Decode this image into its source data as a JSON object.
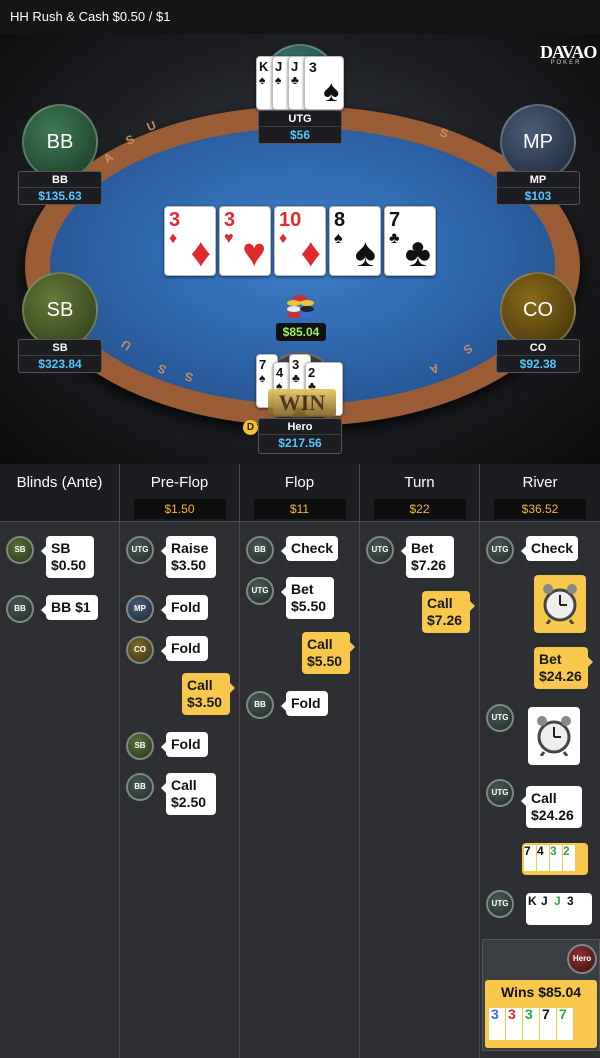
{
  "topbar": {
    "title": "HH  Rush & Cash $0.50 / $1"
  },
  "logo": {
    "brand": "DAVAO",
    "sub": "POKER"
  },
  "rail_letters": [
    "U",
    "S",
    "A",
    "S",
    "S",
    "U",
    "S",
    "A",
    "S",
    "U"
  ],
  "seats": {
    "utg": {
      "name": "UTG",
      "amount": "$56"
    },
    "bb": {
      "label": "BB",
      "name": "BB",
      "amount": "$135.63"
    },
    "mp": {
      "label": "MP",
      "name": "MP",
      "amount": "$103"
    },
    "sb": {
      "label": "SB",
      "name": "SB",
      "amount": "$323.84"
    },
    "co": {
      "label": "CO",
      "name": "CO",
      "amount": "$92.38"
    },
    "hero": {
      "name": "Hero",
      "amount": "$217.56"
    }
  },
  "utg_cards": [
    {
      "rank": "K",
      "suit": "♠"
    },
    {
      "rank": "J",
      "suit": "♠"
    },
    {
      "rank": "J",
      "suit": "♣"
    },
    {
      "rank": "3",
      "suit": "♠"
    }
  ],
  "hero_cards": [
    {
      "rank": "7",
      "suit": "♠"
    },
    {
      "rank": "4",
      "suit": "♠"
    },
    {
      "rank": "3",
      "suit": "♣"
    },
    {
      "rank": "2",
      "suit": "♣"
    }
  ],
  "board": [
    {
      "rank": "3",
      "suit": "♦",
      "color": "red"
    },
    {
      "rank": "3",
      "suit": "♥",
      "color": "red"
    },
    {
      "rank": "10",
      "suit": "♦",
      "color": "red"
    },
    {
      "rank": "8",
      "suit": "♠",
      "color": "blk"
    },
    {
      "rank": "7",
      "suit": "♣",
      "color": "blk"
    }
  ],
  "pot": "$85.04",
  "dealer": "D",
  "win_banner": "WIN",
  "columns": [
    {
      "name": "Blinds (Ante)",
      "pot": ""
    },
    {
      "name": "Pre-Flop",
      "pot": "$1.50"
    },
    {
      "name": "Flop",
      "pot": "$11"
    },
    {
      "name": "Turn",
      "pot": "$22"
    },
    {
      "name": "River",
      "pot": "$36.52"
    }
  ],
  "actions": {
    "blinds": [
      {
        "pos": "SB",
        "line1": "SB",
        "line2": "$0.50"
      },
      {
        "pos": "BB",
        "line1": "BB $1",
        "line2": ""
      }
    ],
    "preflop": [
      {
        "pos": "UTG",
        "line1": "Raise",
        "line2": "$3.50"
      },
      {
        "pos": "MP",
        "line1": "Fold",
        "line2": ""
      },
      {
        "pos": "CO",
        "line1": "Fold",
        "line2": ""
      },
      {
        "pos": "",
        "line1": "Call",
        "line2": "$3.50"
      },
      {
        "pos": "SB",
        "line1": "Fold",
        "line2": ""
      },
      {
        "pos": "BB",
        "line1": "Call",
        "line2": "$2.50"
      }
    ],
    "flop": [
      {
        "pos": "BB",
        "line1": "Check",
        "line2": ""
      },
      {
        "pos": "UTG",
        "line1": "Bet",
        "line2": "$5.50"
      },
      {
        "pos": "",
        "line1": "Call",
        "line2": "$5.50"
      },
      {
        "pos": "BB",
        "line1": "Fold",
        "line2": ""
      }
    ],
    "turn": [
      {
        "pos": "UTG",
        "line1": "Bet",
        "line2": "$7.26"
      },
      {
        "pos": "",
        "line1": "Call",
        "line2": "$7.26"
      }
    ],
    "river": [
      {
        "pos": "UTG",
        "line1": "Check",
        "line2": ""
      },
      {
        "pos": "",
        "line1": "Bet",
        "line2": "$24.26"
      },
      {
        "pos": "UTG",
        "line1": "Call",
        "line2": "$24.26"
      }
    ]
  },
  "river_hero_show": [
    {
      "rank": "7",
      "suit": "♠"
    },
    {
      "rank": "4",
      "suit": "♠"
    },
    {
      "rank": "3",
      "suit": "♣"
    },
    {
      "rank": "2",
      "suit": "♣"
    }
  ],
  "river_utg_show": [
    {
      "rank": "K",
      "suit": "♠"
    },
    {
      "rank": "J",
      "suit": "♠"
    },
    {
      "rank": "J",
      "suit": "♣"
    },
    {
      "rank": "3",
      "suit": "♠"
    }
  ],
  "wins": {
    "pos": "Hero",
    "label": "Wins $85.04",
    "cards": [
      {
        "rank": "3",
        "suit": "♦"
      },
      {
        "rank": "3",
        "suit": "♥"
      },
      {
        "rank": "3",
        "suit": "♣"
      },
      {
        "rank": "7",
        "suit": "♠"
      },
      {
        "rank": "7",
        "suit": "♣"
      }
    ]
  },
  "colors": {
    "pot_text": "#9ef06b",
    "amount_text": "#54c6ff",
    "street_pot": "#f2b33d",
    "bubble_yellow": "#f8c84d"
  }
}
